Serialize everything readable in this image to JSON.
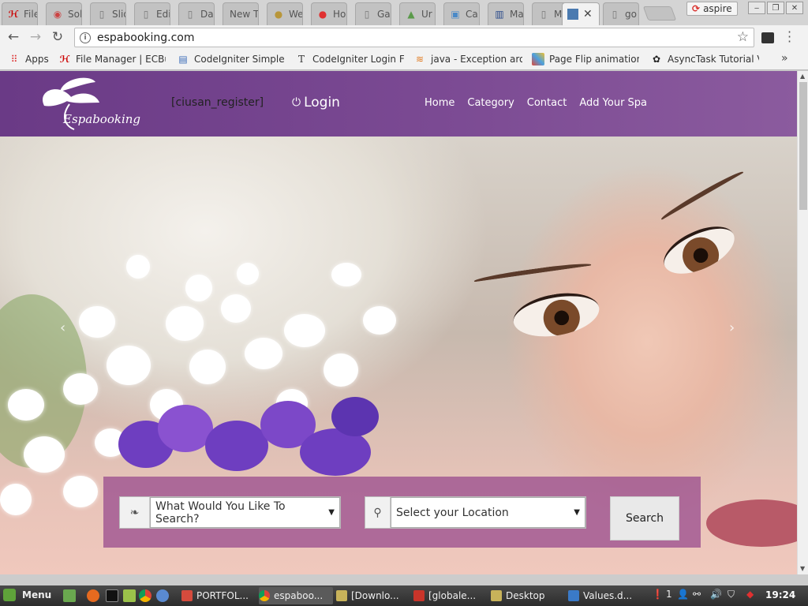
{
  "browser": {
    "tabs": [
      {
        "title": "File",
        "icon": "hi-icon"
      },
      {
        "title": "Sol",
        "icon": "sol-icon"
      },
      {
        "title": "Slid",
        "icon": "page-icon"
      },
      {
        "title": "Edi",
        "icon": "page-icon"
      },
      {
        "title": "Da",
        "icon": "page-icon"
      },
      {
        "title": "New T",
        "icon": "none"
      },
      {
        "title": "We",
        "icon": "coin-icon"
      },
      {
        "title": "Ho",
        "icon": "red-icon"
      },
      {
        "title": "Ga",
        "icon": "page-icon"
      },
      {
        "title": "Ur",
        "icon": "ur-icon"
      },
      {
        "title": "Ca",
        "icon": "ca-icon"
      },
      {
        "title": "Ma",
        "icon": "ma-icon"
      },
      {
        "title": "Me",
        "icon": "page-icon"
      },
      {
        "title": "",
        "icon": "blue-square-icon",
        "active": true
      },
      {
        "title": "go",
        "icon": "page-icon"
      }
    ],
    "profile_name": "aspire",
    "url": "espabooking.com",
    "bookmarks": [
      {
        "label": "Apps",
        "icon": "apps-grid-icon"
      },
      {
        "label": "File Manager | ECBu",
        "icon": "hi-icon"
      },
      {
        "label": "CodeIgniter Simple",
        "icon": "doc-icon"
      },
      {
        "label": "CodeIgniter Login Fo",
        "icon": "t-icon"
      },
      {
        "label": "java - Exception aros",
        "icon": "stack-icon"
      },
      {
        "label": "Page Flip animation",
        "icon": "colorful-icon"
      },
      {
        "label": "AsyncTask Tutorial V",
        "icon": "android-icon"
      }
    ],
    "more": "»"
  },
  "site": {
    "logo_text": "Espabooking",
    "register": "[ciusan_register]",
    "login": "Login",
    "nav": [
      "Home",
      "Category",
      "Contact",
      "Add Your Spa"
    ],
    "carousel_prev": "‹",
    "carousel_next": "›",
    "search": {
      "category_selected": "What Would You Like To Search?",
      "location_selected": "Select your Location",
      "button": "Search"
    }
  },
  "taskbar": {
    "menu": "Menu",
    "windows": [
      {
        "label": "PORTFOL...",
        "color": "#d54b3d"
      },
      {
        "label": "espaboo...",
        "color": "#4a90d9",
        "active": true
      },
      {
        "label": "[Downlo...",
        "color": "#c8b35a"
      },
      {
        "label": "[globale...",
        "color": "#c8342a"
      },
      {
        "label": "Desktop",
        "color": "#c8b35a"
      },
      {
        "label": "Values.d...",
        "color": "#3a7ac8"
      }
    ],
    "notifications": "1",
    "time": "19:24"
  },
  "colors": {
    "header_purple": "#6a3a86",
    "search_panel": "#96468c"
  }
}
